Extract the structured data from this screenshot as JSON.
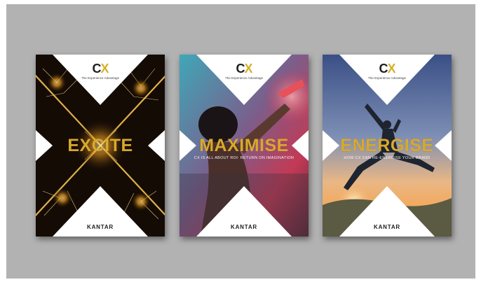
{
  "covers": [
    {
      "logo_c": "C",
      "logo_x": "X",
      "logo_tagline": "The Experience Advantage",
      "headline": "EXCITE",
      "subtitle": "",
      "brand": "KANTAR"
    },
    {
      "logo_c": "C",
      "logo_x": "X",
      "logo_tagline": "The Experience Advantage",
      "headline": "MAXIMISE",
      "subtitle": "CX IS ALL ABOUT ROI: RETURN ON IMAGINATION",
      "brand": "KANTAR"
    },
    {
      "logo_c": "C",
      "logo_x": "X",
      "logo_tagline": "The Experience Advantage",
      "headline": "ENERGISE",
      "subtitle": "HOW CX CAN RE-ENERGISE YOUR BRAND",
      "brand": "KANTAR"
    }
  ],
  "colors": {
    "backdrop": "#b2b2b2",
    "accent_gold": "#d9a92b",
    "panel_white": "#ffffff"
  }
}
